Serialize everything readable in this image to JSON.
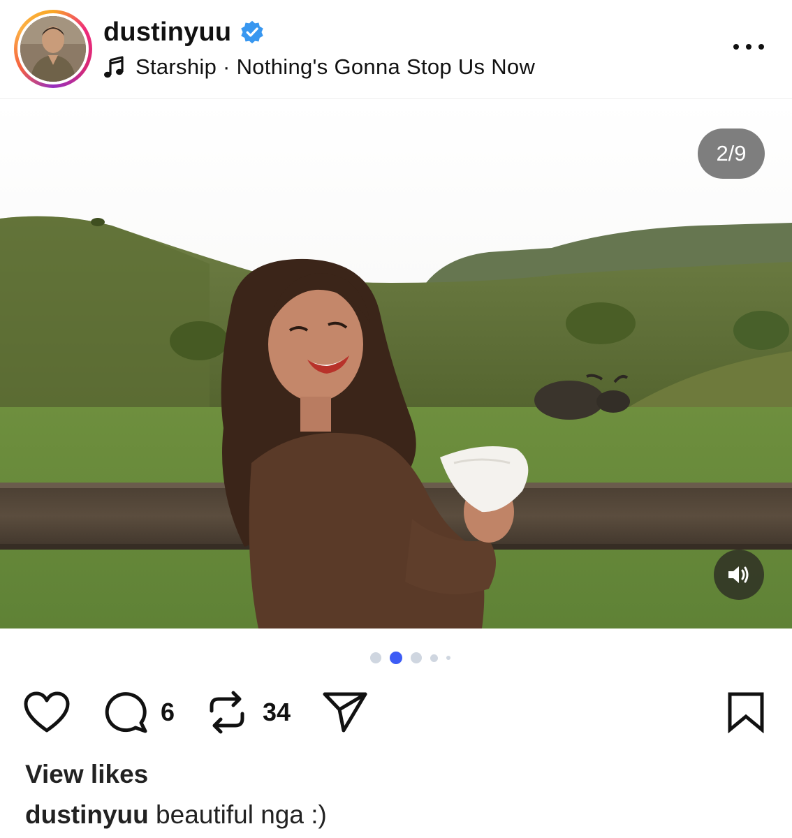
{
  "post": {
    "username": "dustinyuu",
    "music": "Starship · Nothing's Gonna Stop Us Now",
    "counter": "2/9",
    "carousel": {
      "total_dots_visible": 5,
      "active_dot": 1
    },
    "actions": {
      "comments": "6",
      "reposts": "34"
    },
    "view_likes": "View likes",
    "caption": {
      "user": "dustinyuu",
      "text": "beautiful nga :)"
    }
  },
  "icons": {
    "verified": "verified-badge-icon",
    "music": "music-note-icon",
    "more": "more-options-icon",
    "sound": "speaker-icon",
    "like": "heart-icon",
    "comment": "comment-icon",
    "repost": "repost-icon",
    "share": "send-icon",
    "save": "bookmark-icon"
  },
  "colors": {
    "verified": "#3897f0",
    "active_dot": "#3d5cf5",
    "inactive_dot": "#cfd6e0"
  }
}
